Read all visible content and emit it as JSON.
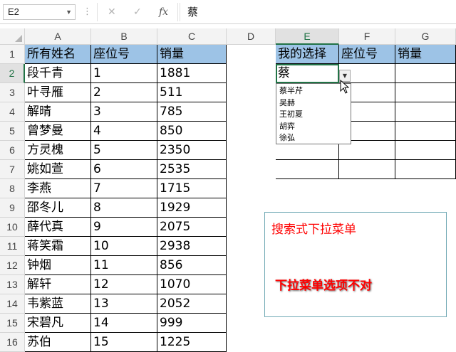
{
  "formula_bar": {
    "name_box": "E2",
    "formula": "蔡",
    "cancel_icon": "✕",
    "enter_icon": "✓",
    "fx_icon": "fx"
  },
  "sheet": {
    "columns": [
      "A",
      "B",
      "C",
      "D",
      "E",
      "F",
      "G"
    ],
    "rows": [
      "1",
      "2",
      "3",
      "4",
      "5",
      "6",
      "7",
      "8",
      "9",
      "10",
      "11",
      "12",
      "13",
      "14",
      "15",
      "16"
    ],
    "source_header": [
      "所有姓名",
      "座位号",
      "销量"
    ],
    "source_rows": [
      [
        "段千青",
        "1",
        "1881"
      ],
      [
        "叶寻雁",
        "2",
        "511"
      ],
      [
        "解晴",
        "3",
        "785"
      ],
      [
        "曾梦曼",
        "4",
        "850"
      ],
      [
        "方灵槐",
        "5",
        "2350"
      ],
      [
        "姚如萱",
        "6",
        "2535"
      ],
      [
        "李燕",
        "7",
        "1715"
      ],
      [
        "邵冬儿",
        "8",
        "1929"
      ],
      [
        "薛代真",
        "9",
        "2075"
      ],
      [
        "蒋笑霜",
        "10",
        "2938"
      ],
      [
        "钟烟",
        "11",
        "856"
      ],
      [
        "解轩",
        "12",
        "1070"
      ],
      [
        "韦紫蓝",
        "13",
        "2052"
      ],
      [
        "宋碧凡",
        "14",
        "999"
      ],
      [
        "苏伯",
        "15",
        "1225"
      ]
    ],
    "lookup_header": [
      "我的选择",
      "座位号",
      "销量"
    ],
    "lookup_value": "蔡",
    "dropdown_options": [
      "蔡半芹",
      "吴赫",
      "王初夏",
      "胡弈",
      "徐弘"
    ]
  },
  "textbox": {
    "title": "搜索式下拉菜单",
    "note": "下拉菜单选项不对"
  },
  "colors": {
    "header_fill": "#9dc3e6",
    "accent": "#217346",
    "note_text": "#ff0000"
  }
}
